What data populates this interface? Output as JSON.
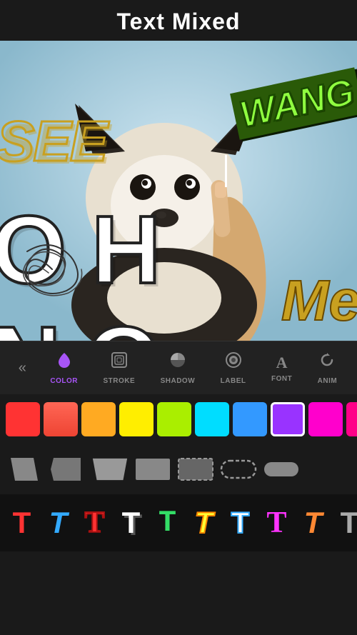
{
  "header": {
    "title": "Text Mixed"
  },
  "toolbar": {
    "back_icon": "«",
    "items": [
      {
        "id": "color",
        "label": "COLOR",
        "icon": "💧",
        "active": true
      },
      {
        "id": "stroke",
        "label": "STROKE",
        "icon": "⊞",
        "active": false
      },
      {
        "id": "shadow",
        "label": "SHADOW",
        "icon": "◑",
        "active": false
      },
      {
        "id": "label",
        "label": "LABEL",
        "icon": "▶",
        "active": false
      },
      {
        "id": "font",
        "label": "FONT",
        "icon": "A",
        "active": false
      },
      {
        "id": "anim",
        "label": "ANIM",
        "icon": "↻",
        "active": false
      }
    ]
  },
  "colors": [
    {
      "id": "red",
      "color": "#ff3333",
      "selected": false
    },
    {
      "id": "coral",
      "color": "#ff6655",
      "selected": false
    },
    {
      "id": "orange",
      "color": "#ff9933",
      "selected": false
    },
    {
      "id": "yellow",
      "color": "#ffee00",
      "selected": false
    },
    {
      "id": "lime",
      "color": "#aaee00",
      "selected": false
    },
    {
      "id": "cyan",
      "color": "#00ccff",
      "selected": false
    },
    {
      "id": "blue",
      "color": "#4499ff",
      "selected": false
    },
    {
      "id": "purple",
      "color": "#9933ff",
      "selected": true
    },
    {
      "id": "pink",
      "color": "#ff00cc",
      "selected": false
    },
    {
      "id": "magenta",
      "color": "#ff0088",
      "selected": false
    },
    {
      "id": "hot-pink",
      "color": "#ff1155",
      "selected": false
    },
    {
      "id": "multi",
      "color": "multi",
      "selected": false
    }
  ],
  "font_colors": [
    "#ff3333",
    "#33aaff",
    "#33ff66",
    "#ffffff",
    "#222222",
    "#ffff33",
    "#ff33ff",
    "#ff8833",
    "#aaaaaa",
    "#ff5555"
  ],
  "canvas_texts": {
    "see": "SEE",
    "wang": "WANG",
    "oh_no": "OH  NO",
    "me": "Me"
  }
}
